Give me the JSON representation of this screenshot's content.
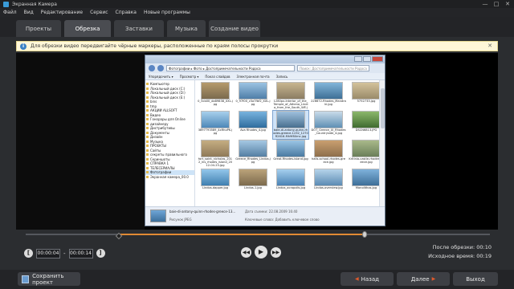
{
  "window": {
    "title": "Экранная Камера",
    "controls": [
      "—",
      "□",
      "✕"
    ]
  },
  "menu": [
    "Файл",
    "Вид",
    "Редактирование",
    "Сервис",
    "Справка",
    "Новые программы"
  ],
  "tabs": [
    {
      "label": "Проекты",
      "active": false
    },
    {
      "label": "Обрезка",
      "active": true
    },
    {
      "label": "Заставки",
      "active": false
    },
    {
      "label": "Музыка",
      "active": false
    },
    {
      "label": "Создание видео",
      "active": false
    }
  ],
  "info": {
    "icon": "info-icon",
    "text": "Для обрезки видео передвигайте чёрные маркеры, расположенные по краям полосы прокрутки",
    "close": "✕"
  },
  "explorer": {
    "path": "Фотографии ▸ Фото ▸ Достопримечательности Родоса",
    "search": "Поиск: Достопримечательности Родоса",
    "toolbar": [
      "Упорядочить ▾",
      "Просмотр ▾",
      "Показ слайдов",
      "Электронная почта",
      "Запись"
    ],
    "sidebar": [
      "Компьютер",
      "Локальный диск (C:)",
      "Локальный диск (D:)",
      "Локальный диск (E:)",
      "bins",
      "tmp",
      "АКЦИИ ALLSOFT",
      "Видео",
      "Гонорары для Online",
      "дизайнеру",
      "Дистрибутивы",
      "Документы",
      "Дизайн",
      "Музыка",
      "ПРОЕКТЫ",
      "Сайты",
      "секреты правильного",
      "Скриншоты",
      "СПРАВКА 1",
      "ТЕЛЕСЕРИАЛЫ",
      "Фотографии",
      "Экранная камера_00.0"
    ],
    "thumbnails": [
      {
        "label": "0_5cb00_da89838_XXL.jpg"
      },
      {
        "label": "0_97f00_c5a7fbf2_XXL.jpg"
      },
      {
        "label": "1280px-Interior_of_the_Temple_of_Athena_Lindia_from_the_South_WE.jpg"
      },
      {
        "label": "226672-Rhodes_Mandraki.jpg"
      },
      {
        "label": "5752733.jpg"
      },
      {
        "label": "3897T93589_4xRhoPK.jpg"
      },
      {
        "label": "Ava Rhodes_4.jpg"
      },
      {
        "label": "baie-di-antony-quinn-rhodes-greece-1232_1270R2616-Mh9f80mc.jpg"
      },
      {
        "label": "DOT_Greece_Ul_Rhodes_Countryside_4.jpg"
      },
      {
        "label": "DSCN6813.JPG"
      },
      {
        "label": "fort_saint_nicholas_2012_ins_rhodes_island_2012-04-23.jpg"
      },
      {
        "label": "Greece_Rhodes_Lindos.jpg"
      },
      {
        "label": "Great-Rhodes-island.jpg"
      },
      {
        "label": "halls-school-rhodes-greece.jpg"
      },
      {
        "label": "Kritinia-castle-rhodes-greece.jpg"
      },
      {
        "label": "Lindos-dapper.jpg"
      },
      {
        "label": "Lindos-1.jpg"
      },
      {
        "label": "Lindos_acropolis.jpg"
      },
      {
        "label": "Lindos-overview.jpg"
      },
      {
        "label": "Monolithos.jpg"
      }
    ],
    "status": {
      "name": "baie-di-antony-quinn-rhodes-greece-13...",
      "kind": "Рисунок JPEG",
      "date": "Дата съемки: 22.08.2009 16:40",
      "size": "Ключевые слова: Добавить ключевое слово"
    }
  },
  "timeline": {
    "start_fraction": 0.2,
    "end_fraction": 0.73
  },
  "trim": {
    "start": "00:00:04",
    "separator": "-",
    "end": "00:00:14",
    "left_button": "[",
    "right_button": "]"
  },
  "player": {
    "prev": "◀◀",
    "play": "▶",
    "next": "▶▶"
  },
  "duration": {
    "after_label": "После обрезки:",
    "after_value": "00:10",
    "original_label": "Исходное время:",
    "original_value": "00:19"
  },
  "footer": {
    "save_label": "Сохранить проект",
    "back_label": "Назад",
    "next_label": "Далее",
    "exit_label": "Выход"
  },
  "colors": {
    "accent": "#e08a34",
    "nav_arrow": "#e05a2c",
    "info_bg": "#fff7d8"
  }
}
